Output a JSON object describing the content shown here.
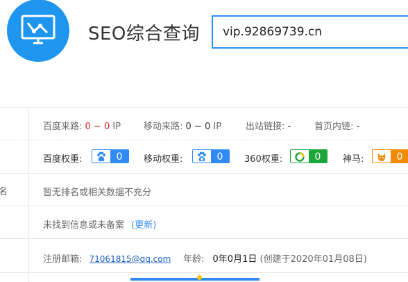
{
  "header": {
    "logo_icon": "monitor-chart-icon",
    "title": "SEO综合查询",
    "search_value": "vip.92869739.cn"
  },
  "traffic": {
    "baidu_label": "百度来路:",
    "baidu_value": "0 ~ 0",
    "baidu_unit": "IP",
    "mobile_label": "移动来路:",
    "mobile_value": "0 ~ 0",
    "mobile_unit": "IP",
    "outlinks_label": "出站链接:",
    "outlinks_value": "-",
    "homelinks_label": "首页内链:",
    "homelinks_value": "-"
  },
  "weights": {
    "baidu_label": "百度权重:",
    "baidu_value": "0",
    "mobile_label": "移动权重:",
    "mobile_value": "0",
    "so360_label": "360权重:",
    "so360_value": "0",
    "shenma_label": "神马:",
    "shenma_value": "0",
    "colors": {
      "blue": "#2f8af3",
      "green": "#1ca63a",
      "orange": "#f08a00"
    }
  },
  "ranking": {
    "side_label": "名",
    "text": "暂无排名或相关数据不充分"
  },
  "icp": {
    "text": "未找到信息或未备案",
    "update_link": "(更新)"
  },
  "whois": {
    "email_label": "注册邮箱:",
    "email_value": "71061815@qq.com",
    "age_label": "年龄:",
    "age_value": "0年0月1日",
    "created_text": "(创建于2020年01月08日)"
  }
}
